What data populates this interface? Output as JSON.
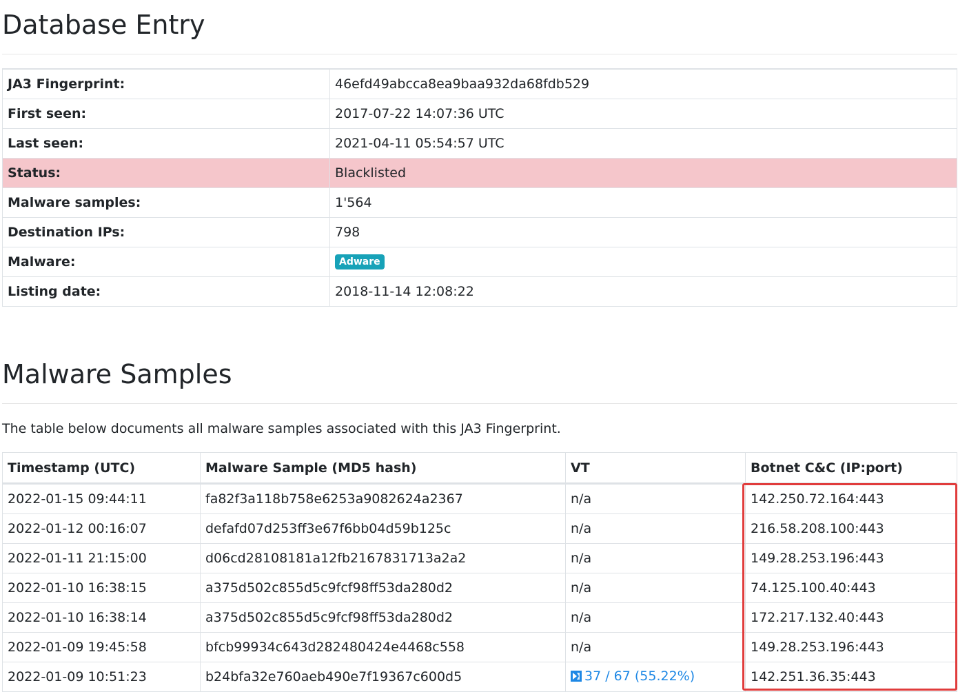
{
  "headings": {
    "database_entry": "Database Entry",
    "malware_samples": "Malware Samples"
  },
  "entry": [
    {
      "label": "JA3 Fingerprint:",
      "value": "46efd49abcca8ea9baa932da68fdb529"
    },
    {
      "label": "First seen:",
      "value": "2017-07-22 14:07:36 UTC"
    },
    {
      "label": "Last seen:",
      "value": "2021-04-11 05:54:57 UTC"
    },
    {
      "label": "Status:",
      "value": "Blacklisted"
    },
    {
      "label": "Malware samples:",
      "value": "1'564"
    },
    {
      "label": "Destination IPs:",
      "value": "798"
    },
    {
      "label": "Malware:",
      "value": "Adware"
    },
    {
      "label": "Listing date:",
      "value": "2018-11-14 12:08:22"
    }
  ],
  "intro_text": "The table below documents all malware samples associated with this JA3 Fingerprint.",
  "samples": {
    "columns": [
      "Timestamp (UTC)",
      "Malware Sample (MD5 hash)",
      "VT",
      "Botnet C&C (IP:port)"
    ],
    "rows": [
      {
        "timestamp": "2022-01-15 09:44:11",
        "md5": "fa82f3a118b758e6253a9082624a2367",
        "vt": "n/a",
        "cc": "142.250.72.164:443"
      },
      {
        "timestamp": "2022-01-12 00:16:07",
        "md5": "defafd07d253ff3e67f6bb04d59b125c",
        "vt": "n/a",
        "cc": "216.58.208.100:443"
      },
      {
        "timestamp": "2022-01-11 21:15:00",
        "md5": "d06cd28108181a12fb2167831713a2a2",
        "vt": "n/a",
        "cc": "149.28.253.196:443"
      },
      {
        "timestamp": "2022-01-10 16:38:15",
        "md5": "a375d502c855d5c9fcf98ff53da280d2",
        "vt": "n/a",
        "cc": "74.125.100.40:443"
      },
      {
        "timestamp": "2022-01-10 16:38:14",
        "md5": "a375d502c855d5c9fcf98ff53da280d2",
        "vt": "n/a",
        "cc": "172.217.132.40:443"
      },
      {
        "timestamp": "2022-01-09 19:45:58",
        "md5": "bfcb99934c643d282480424e4468c558",
        "vt": "n/a",
        "cc": "149.28.253.196:443"
      },
      {
        "timestamp": "2022-01-09 10:51:23",
        "md5": "b24bfa32e760aeb490e7f19367c600d5",
        "vt": "37 / 67 (55.22%)",
        "cc": "142.251.36.35:443"
      }
    ]
  },
  "colors": {
    "danger_row": "#f5c6cb",
    "badge": "#17a2b8",
    "link": "#1e88e5",
    "highlight": "#e03c3c"
  },
  "icons": {
    "vt": "virustotal-icon"
  }
}
